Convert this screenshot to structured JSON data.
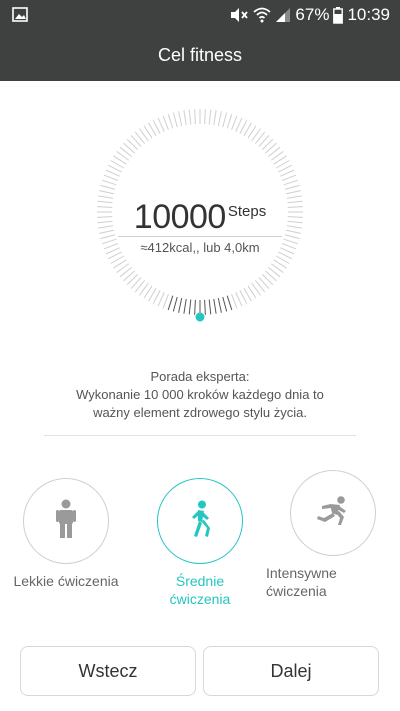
{
  "status_bar": {
    "battery_percent": "67%",
    "time": "10:39",
    "icons": [
      "gallery-icon",
      "mute-icon",
      "wifi-icon",
      "signal-icon",
      "battery-icon"
    ]
  },
  "header": {
    "title": "Cel fitness"
  },
  "goal": {
    "steps": "10000",
    "unit": "Steps",
    "estimate": "≈412kcal,, lub 4,0km"
  },
  "tip": {
    "title": "Porada eksperta:",
    "line1": "Wykonanie 10 000 kroków każdego dnia to",
    "line2": "ważny element zdrowego stylu życia."
  },
  "levels": [
    {
      "label": "Lekkie ćwiczenia",
      "icon": "standing-person-icon",
      "selected": false
    },
    {
      "label": "Średnie ćwiczenia",
      "icon": "walking-person-icon",
      "selected": true
    },
    {
      "label_line1": "Intensywne",
      "label_line2": "ćwiczenia",
      "icon": "running-person-icon",
      "selected": false
    }
  ],
  "buttons": {
    "back": "Wstecz",
    "next": "Dalej"
  },
  "colors": {
    "accent": "#25c6c2",
    "header_bg": "#3f4040"
  }
}
